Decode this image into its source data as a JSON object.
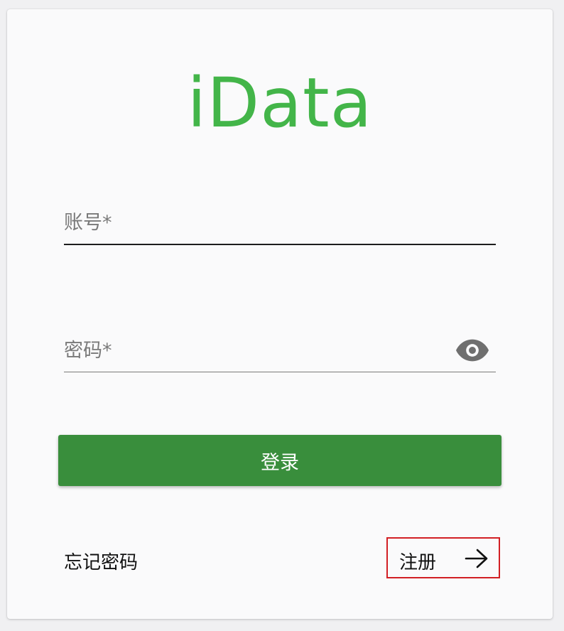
{
  "app": {
    "logo_text": "iData",
    "brand_color": "#43b549",
    "primary_button_color": "#398e3c"
  },
  "form": {
    "account": {
      "placeholder": "账号*",
      "value": ""
    },
    "password": {
      "placeholder": "密码*",
      "value": "",
      "visibility_icon": "eye-icon"
    },
    "login_label": "登录"
  },
  "footer": {
    "forgot_password_label": "忘记密码",
    "register_label": "注册",
    "register_icon": "arrow-right-icon",
    "highlight_color": "#d21f24"
  }
}
